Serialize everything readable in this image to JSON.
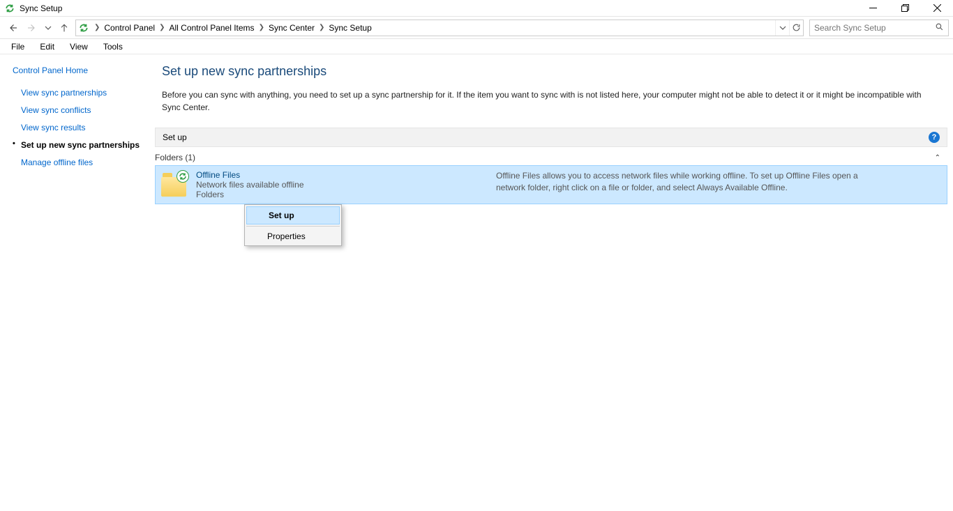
{
  "window": {
    "title": "Sync Setup"
  },
  "breadcrumb": {
    "items": [
      "Control Panel",
      "All Control Panel Items",
      "Sync Center",
      "Sync Setup"
    ]
  },
  "search": {
    "placeholder": "Search Sync Setup"
  },
  "menu": {
    "file": "File",
    "edit": "Edit",
    "view": "View",
    "tools": "Tools"
  },
  "sidebar": {
    "home": "Control Panel Home",
    "links": {
      "view_partnerships": "View sync partnerships",
      "view_conflicts": "View sync conflicts",
      "view_results": "View sync results",
      "setup_new": "Set up new sync partnerships",
      "manage_offline": "Manage offline files"
    }
  },
  "main": {
    "title": "Set up new sync partnerships",
    "description": "Before you can sync with anything, you need to set up a sync partnership for it. If the item you want to sync with is not listed here, your computer might not be able to detect it or it might be incompatible with Sync Center.",
    "toolbar_label": "Set up",
    "group_label": "Folders (1)",
    "item": {
      "name": "Offline Files",
      "sub1": "Network files available offline",
      "sub2": "Folders",
      "desc": "Offline Files allows you to access network files while working offline. To set up Offline Files open a network folder, right click on a file or folder, and select Always Available Offline."
    }
  },
  "context_menu": {
    "setup": "Set up",
    "properties": "Properties"
  }
}
